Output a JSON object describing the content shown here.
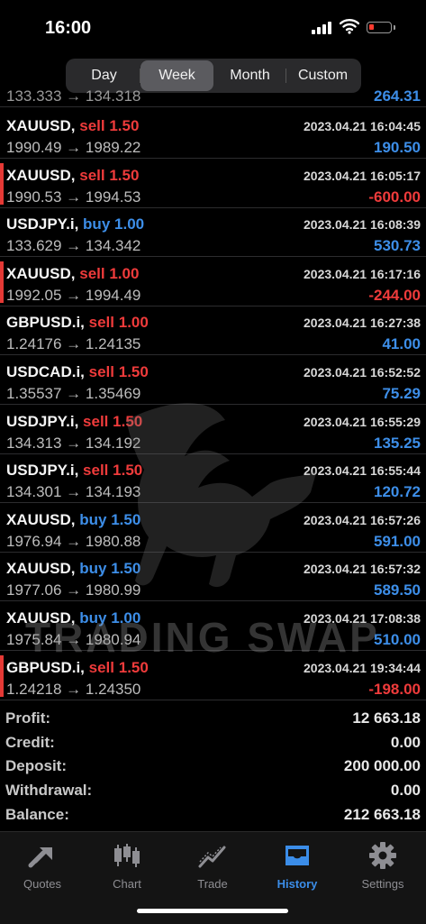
{
  "status": {
    "time": "16:00"
  },
  "colors": {
    "sell": "#ef3b3b",
    "buy": "#3d8ee8",
    "accent": "#3b8de8"
  },
  "segments": [
    "Day",
    "Week",
    "Month",
    "Custom"
  ],
  "active_segment": "Week",
  "partial_row": {
    "prices": "133.333 → 134.318",
    "profit": "264.31"
  },
  "trades": [
    {
      "symbol": "XAUUSD,",
      "side": "sell",
      "volume": "1.50",
      "datetime": "2023.04.21 16:04:45",
      "open": "1990.49",
      "close": "1989.22",
      "profit": "190.50",
      "profit_sign": "pos"
    },
    {
      "symbol": "XAUUSD,",
      "side": "sell",
      "volume": "1.50",
      "datetime": "2023.04.21 16:05:17",
      "open": "1990.53",
      "close": "1994.53",
      "profit": "-600.00",
      "profit_sign": "neg"
    },
    {
      "symbol": "USDJPY.i,",
      "side": "buy",
      "volume": "1.00",
      "datetime": "2023.04.21 16:08:39",
      "open": "133.629",
      "close": "134.342",
      "profit": "530.73",
      "profit_sign": "pos"
    },
    {
      "symbol": "XAUUSD,",
      "side": "sell",
      "volume": "1.00",
      "datetime": "2023.04.21 16:17:16",
      "open": "1992.05",
      "close": "1994.49",
      "profit": "-244.00",
      "profit_sign": "neg"
    },
    {
      "symbol": "GBPUSD.i,",
      "side": "sell",
      "volume": "1.00",
      "datetime": "2023.04.21 16:27:38",
      "open": "1.24176",
      "close": "1.24135",
      "profit": "41.00",
      "profit_sign": "pos"
    },
    {
      "symbol": "USDCAD.i,",
      "side": "sell",
      "volume": "1.50",
      "datetime": "2023.04.21 16:52:52",
      "open": "1.35537",
      "close": "1.35469",
      "profit": "75.29",
      "profit_sign": "pos"
    },
    {
      "symbol": "USDJPY.i,",
      "side": "sell",
      "volume": "1.50",
      "datetime": "2023.04.21 16:55:29",
      "open": "134.313",
      "close": "134.192",
      "profit": "135.25",
      "profit_sign": "pos"
    },
    {
      "symbol": "USDJPY.i,",
      "side": "sell",
      "volume": "1.50",
      "datetime": "2023.04.21 16:55:44",
      "open": "134.301",
      "close": "134.193",
      "profit": "120.72",
      "profit_sign": "pos"
    },
    {
      "symbol": "XAUUSD,",
      "side": "buy",
      "volume": "1.50",
      "datetime": "2023.04.21 16:57:26",
      "open": "1976.94",
      "close": "1980.88",
      "profit": "591.00",
      "profit_sign": "pos"
    },
    {
      "symbol": "XAUUSD,",
      "side": "buy",
      "volume": "1.50",
      "datetime": "2023.04.21 16:57:32",
      "open": "1977.06",
      "close": "1980.99",
      "profit": "589.50",
      "profit_sign": "pos"
    },
    {
      "symbol": "XAUUSD,",
      "side": "buy",
      "volume": "1.00",
      "datetime": "2023.04.21 17:08:38",
      "open": "1975.84",
      "close": "1980.94",
      "profit": "510.00",
      "profit_sign": "pos"
    },
    {
      "symbol": "GBPUSD.i,",
      "side": "sell",
      "volume": "1.50",
      "datetime": "2023.04.21 19:34:44",
      "open": "1.24218",
      "close": "1.24350",
      "profit": "-198.00",
      "profit_sign": "neg"
    }
  ],
  "watermark": {
    "text": "TRADING SWAP"
  },
  "summary": [
    {
      "label": "Profit:",
      "value": "12 663.18"
    },
    {
      "label": "Credit:",
      "value": "0.00"
    },
    {
      "label": "Deposit:",
      "value": "200 000.00"
    },
    {
      "label": "Withdrawal:",
      "value": "0.00"
    },
    {
      "label": "Balance:",
      "value": "212 663.18"
    }
  ],
  "tabs": [
    {
      "label": "Quotes",
      "icon": "quotes-arrows-icon"
    },
    {
      "label": "Chart",
      "icon": "candlestick-icon"
    },
    {
      "label": "Trade",
      "icon": "trend-line-icon"
    },
    {
      "label": "History",
      "icon": "inbox-icon",
      "active": true
    },
    {
      "label": "Settings",
      "icon": "gear-icon"
    }
  ]
}
